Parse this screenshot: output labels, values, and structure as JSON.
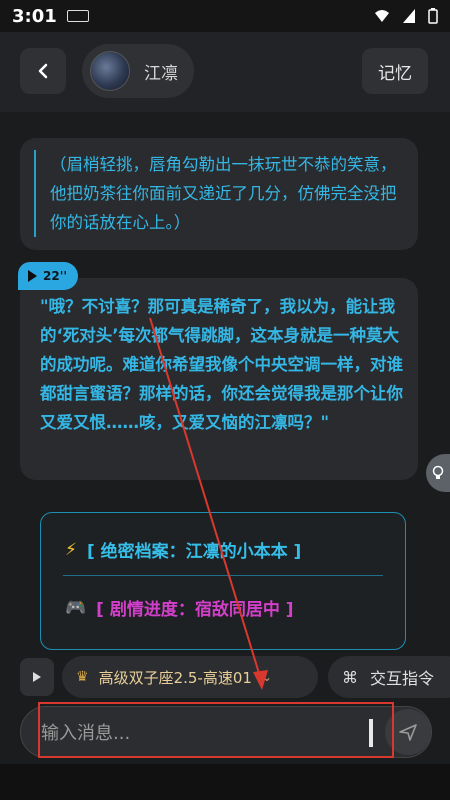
{
  "status_bar": {
    "time": "3:01"
  },
  "header": {
    "back_icon": "chevron-left-icon",
    "character_name": "江凛",
    "memory_label": "记忆"
  },
  "messages": {
    "narration": "（眉梢轻挑，唇角勾勒出一抹玩世不恭的笑意，他把奶茶往你面前又递近了几分，仿佛完全没把你的话放在心上。）",
    "voice_duration": "22''",
    "speech": "\"哦？不讨喜？那可真是稀奇了，我以为，能让我的‘死对头’每次都气得跳脚，这本身就是一种莫大的成功呢。难道你希望我像个中央空调一样，对谁都甜言蜜语？那样的话，你还会觉得我是那个让你又爱又恨……咳，又爱又恼的江凛吗？\""
  },
  "info_card": {
    "item1_icon": "lightning-icon",
    "item1_label": "[ 绝密档案：江凛的小本本 ]",
    "item2_icon": "gamepad-icon",
    "item2_label": "[ 剧情进度：宿敌同居中 ]"
  },
  "toolbar": {
    "model_label": "高级双子座2.5-高速01",
    "command_label": "交互指令"
  },
  "input": {
    "placeholder": "输入消息..."
  },
  "colors": {
    "accent_blue": "#35b7e5",
    "accent_magenta": "#d23fc9",
    "annotation_red": "#d9382f"
  }
}
